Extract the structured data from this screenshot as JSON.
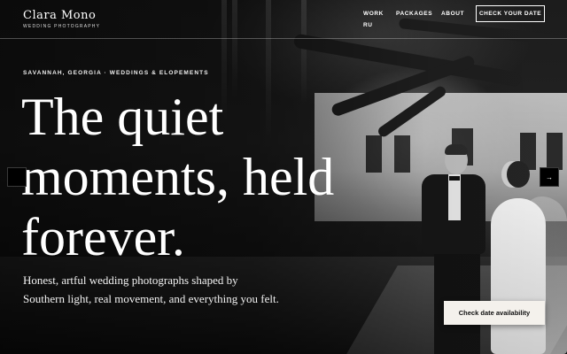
{
  "brand": {
    "name": "Clara Mono",
    "tagline": "WEDDING PHOTOGRAPHY"
  },
  "nav": {
    "items": [
      "WORK",
      "PACKAGES",
      "ABOUT",
      "RU"
    ],
    "cta": "CHECK YOUR DATE"
  },
  "hero": {
    "eyebrow": "SAVANNAH, GEORGIA · WEDDINGS & ELOPEMENTS",
    "headline_lines": [
      "The quiet",
      "moments, held",
      "forever."
    ],
    "subtext": "Honest, artful wedding photographs shaped by Southern light, real movement, and everything you felt.",
    "cta": "Check date availability",
    "image": "black-and-white-couple-under-oak-trees"
  },
  "carousel": {
    "prev_icon": "arrow-left-icon",
    "next_icon": "arrow-right-icon",
    "next_glyph": "→"
  }
}
